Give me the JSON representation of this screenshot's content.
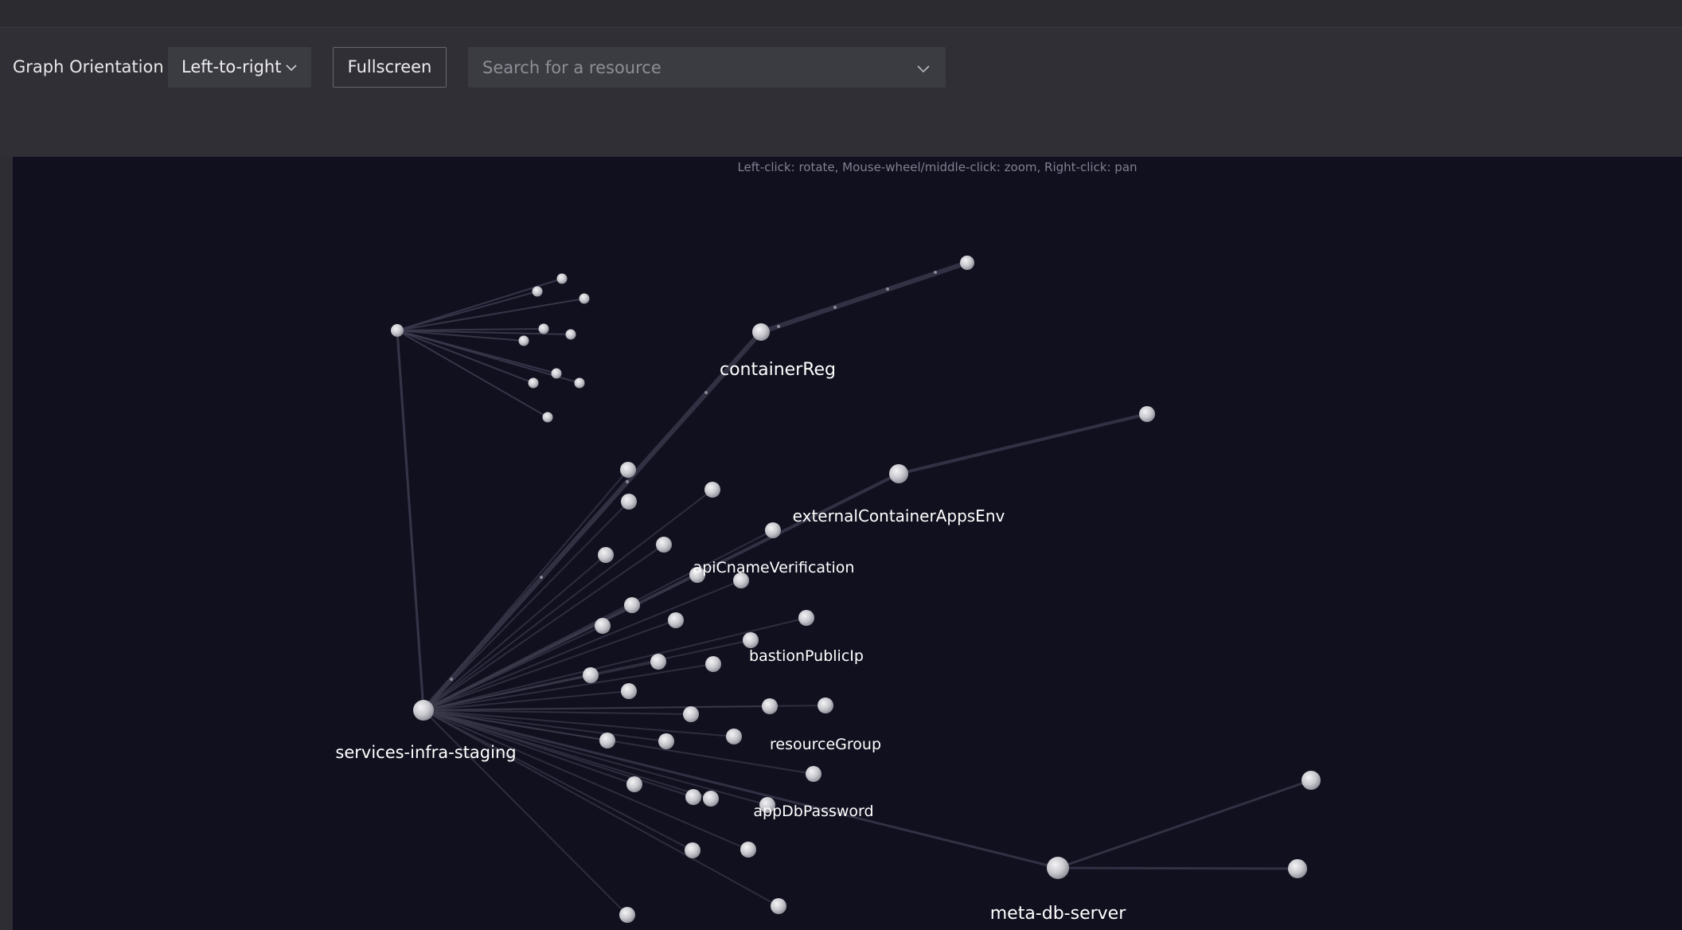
{
  "toolbar": {
    "orientation_label": "Graph Orientation",
    "orientation_value": "Left-to-right",
    "fullscreen_label": "Fullscreen",
    "search_placeholder": "Search for a resource"
  },
  "graph": {
    "hint": "Left-click: rotate, Mouse-wheel/middle-click: zoom, Right-click: pan",
    "labels": {
      "root": "services-infra-staging",
      "container_reg": "containerReg",
      "external_env": "externalContainerAppsEnv",
      "api_cname": "apiCnameVerification",
      "bastion_ip": "bastionPublicIp",
      "resource_group": "resourceGroup",
      "app_db_password": "appDbPassword",
      "meta_db_server": "meta-db-server"
    }
  },
  "colors": {
    "graph_background": "#11101f",
    "node": "#cfcfd4",
    "link": "#3a3a4c"
  }
}
